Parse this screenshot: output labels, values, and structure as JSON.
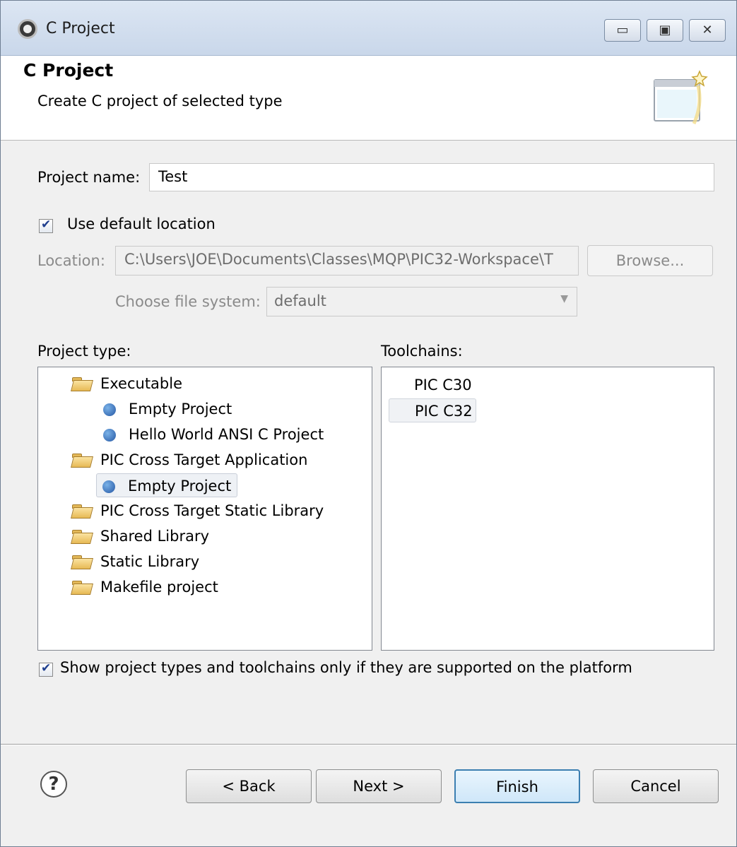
{
  "window": {
    "title": "C Project",
    "minimize_glyph": "▭",
    "maximize_glyph": "▣",
    "close_glyph": "✕"
  },
  "banner": {
    "title": "C Project",
    "description": "Create C project of selected type"
  },
  "form": {
    "project_name_label": "Project name:",
    "project_name_value": "Test",
    "use_default_location_label": "Use default location",
    "use_default_location_checked": true,
    "location_label": "Location:",
    "location_value": "C:\\Users\\JOE\\Documents\\Classes\\MQP\\PIC32-Workspace\\T",
    "browse_label": "Browse...",
    "file_system_label": "Choose file system:",
    "file_system_value": "default"
  },
  "project_type": {
    "label": "Project type:",
    "items": [
      {
        "label": "Executable",
        "kind": "folder"
      },
      {
        "label": "Empty Project",
        "kind": "template"
      },
      {
        "label": "Hello World ANSI C Project",
        "kind": "template"
      },
      {
        "label": "PIC Cross Target Application",
        "kind": "folder"
      },
      {
        "label": "Empty Project",
        "kind": "template",
        "selected": true
      },
      {
        "label": "PIC Cross Target Static Library",
        "kind": "folder"
      },
      {
        "label": "Shared Library",
        "kind": "folder"
      },
      {
        "label": "Static Library",
        "kind": "folder"
      },
      {
        "label": "Makefile project",
        "kind": "folder"
      }
    ]
  },
  "toolchains": {
    "label": "Toolchains:",
    "items": [
      {
        "label": "PIC C30"
      },
      {
        "label": "PIC C32",
        "selected": true
      }
    ]
  },
  "filter": {
    "label": "Show project types and toolchains only if they are supported on the platform",
    "checked": true
  },
  "buttons": {
    "help_glyph": "?",
    "back": "< Back",
    "next": "Next >",
    "finish": "Finish",
    "cancel": "Cancel"
  }
}
